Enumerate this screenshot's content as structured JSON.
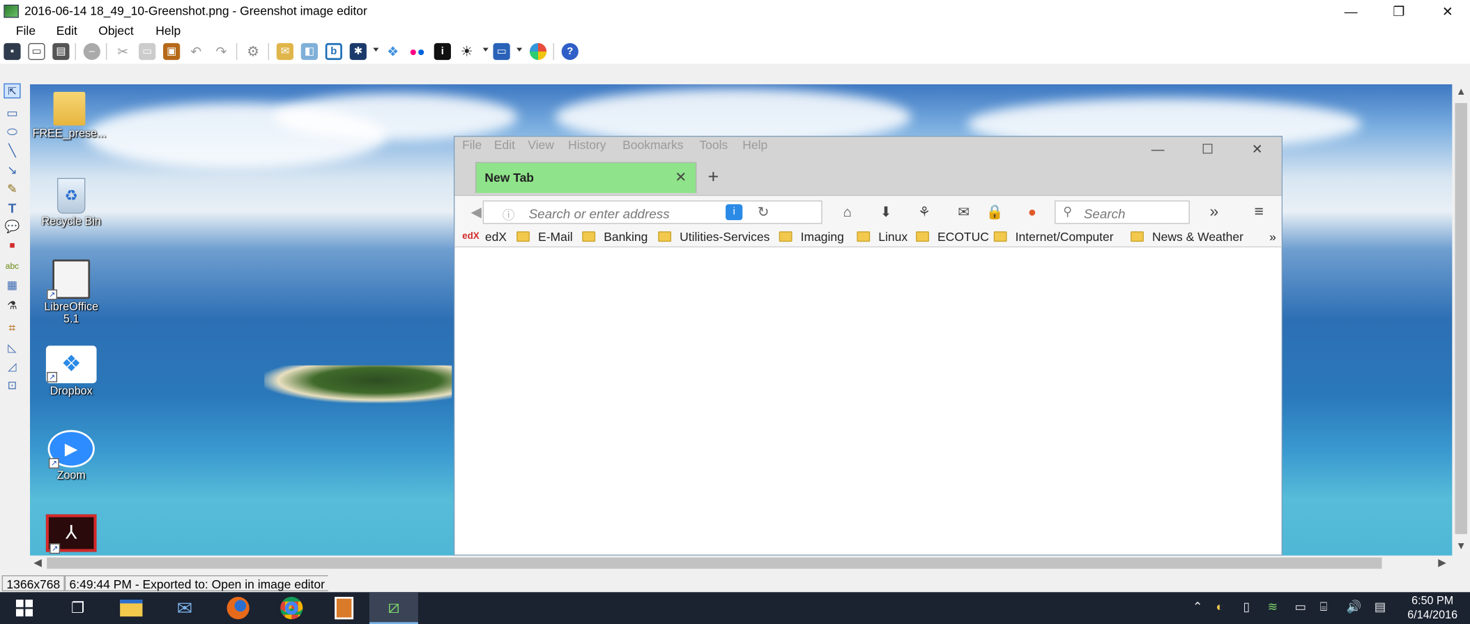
{
  "window": {
    "title": "2016-06-14 18_49_10-Greenshot.png - Greenshot image editor",
    "minimize": "—",
    "restore": "❐",
    "close": "✕"
  },
  "menubar": {
    "items": [
      "File",
      "Edit",
      "Object",
      "Help"
    ]
  },
  "toolbar": {
    "buttons": [
      "save-icon",
      "copy-icon",
      "print-icon",
      "delete-icon",
      "cut-icon",
      "copy-icon",
      "paste-icon",
      "undo-icon",
      "redo-icon",
      "settings-icon",
      "email-icon",
      "office-icon",
      "imgur-icon",
      "box-icon",
      "dropbox-icon",
      "flickr-icon",
      "info-icon",
      "effects-icon",
      "capture-icon",
      "picasa-icon",
      "help-icon"
    ],
    "accent": "#3a7bd5"
  },
  "tools": [
    "select",
    "rectangle",
    "ellipse",
    "line",
    "arrow",
    "freehand",
    "text",
    "speechbubble",
    "counter",
    "highlight",
    "obfuscate",
    "effects",
    "crop",
    "rotate-cw",
    "rotate-ccw",
    "resize"
  ],
  "desktop": {
    "icons": [
      {
        "label": "FREE_prese...",
        "icon": "folder-icon"
      },
      {
        "label": "Recycle Bin",
        "icon": "recycle-bin-icon"
      },
      {
        "label": "LibreOffice",
        "label2": "5.1",
        "icon": "libreoffice-icon"
      },
      {
        "label": "Dropbox",
        "icon": "dropbox-icon"
      },
      {
        "label": "Zoom",
        "icon": "zoom-icon"
      },
      {
        "label": "",
        "icon": "acrobat-icon"
      }
    ]
  },
  "firefox": {
    "menu": [
      "File",
      "Edit",
      "View",
      "History",
      "Bookmarks",
      "Tools",
      "Help"
    ],
    "tab": {
      "label": "New Tab",
      "close": "✕"
    },
    "newtab": "+",
    "url_placeholder": "Search or enter address",
    "search_placeholder": "Search",
    "overflow": "»",
    "bookmarks": [
      {
        "label": "edX",
        "icon": "edx-icon"
      },
      {
        "label": "E-Mail",
        "icon": "folder-icon"
      },
      {
        "label": "Banking",
        "icon": "folder-icon"
      },
      {
        "label": "Utilities-Services",
        "icon": "folder-icon"
      },
      {
        "label": "Imaging",
        "icon": "folder-icon"
      },
      {
        "label": "Linux",
        "icon": "folder-icon"
      },
      {
        "label": "ECOTUC",
        "icon": "folder-icon"
      },
      {
        "label": "Internet/Computer",
        "icon": "folder-icon"
      },
      {
        "label": "News & Weather",
        "icon": "folder-icon"
      }
    ],
    "bookmarks_overflow": "»",
    "tab_color": "#8fe38a"
  },
  "status": {
    "size": "1366x768",
    "message": "6:49:44 PM - Exported to: Open in image editor"
  },
  "taskbar": {
    "apps": [
      "windows-start-icon",
      "task-view-icon",
      "file-explorer-icon",
      "thunderbird-icon",
      "firefox-icon",
      "chrome-icon",
      "libreoffice-impress-icon",
      "greenshot-icon"
    ],
    "clock_time": "6:50 PM",
    "clock_date": "6/14/2016"
  }
}
